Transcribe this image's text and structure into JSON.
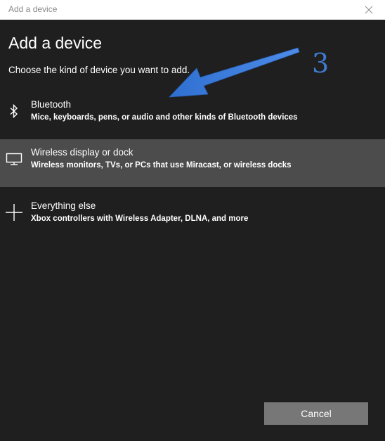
{
  "window": {
    "title": "Add a device"
  },
  "header": {
    "heading": "Add a device",
    "subheading": "Choose the kind of device you want to add."
  },
  "options": [
    {
      "title": "Bluetooth",
      "description": "Mice, keyboards, pens, or audio and other kinds of Bluetooth devices",
      "icon": "bluetooth-icon",
      "selected": false
    },
    {
      "title": "Wireless display or dock",
      "description": "Wireless monitors, TVs, or PCs that use Miracast, or wireless docks",
      "icon": "monitor-icon",
      "selected": true
    },
    {
      "title": "Everything else",
      "description": "Xbox controllers with Wireless Adapter, DLNA, and more",
      "icon": "plus-icon",
      "selected": false
    }
  ],
  "annotation": {
    "number": "3",
    "color": "#3f7cd1"
  },
  "footer": {
    "cancel_label": "Cancel"
  },
  "colors": {
    "background": "#1f1f1f",
    "selected_row": "#4c4c4c",
    "button": "#777777",
    "titlebar": "#ffffff"
  }
}
